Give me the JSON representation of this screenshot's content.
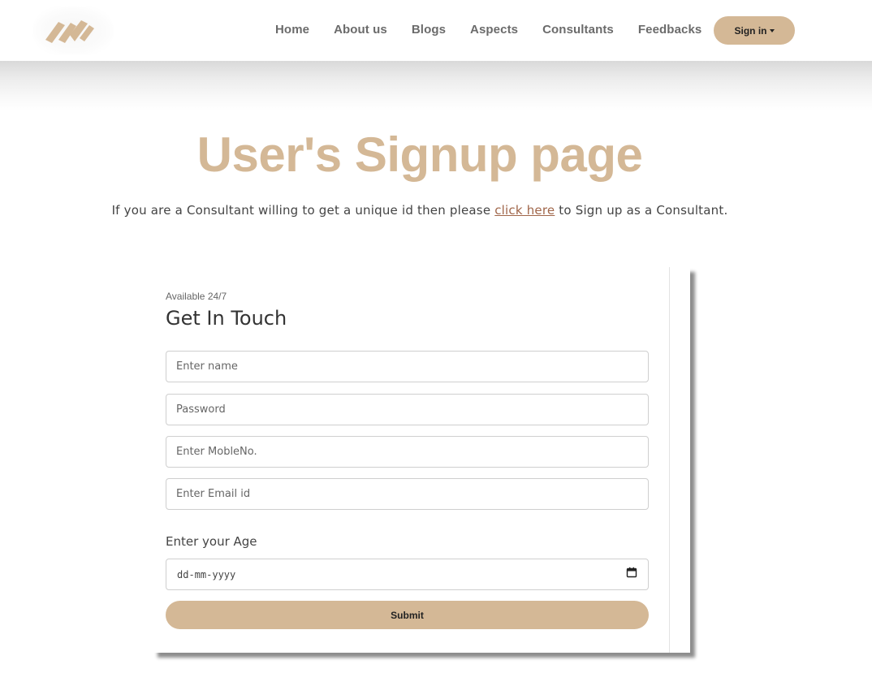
{
  "nav": {
    "links": [
      "Home",
      "About us",
      "Blogs",
      "Aspects",
      "Consultants",
      "Feedbacks"
    ],
    "signin_label": "Sign in"
  },
  "page": {
    "title": "User's Signup page",
    "subtitle_before": "If you are a Consultant willing to get a unique id then please ",
    "subtitle_link": "click here",
    "subtitle_after": " to Sign up as a Consultant."
  },
  "form": {
    "available": "Available 24/7",
    "heading": "Get In Touch",
    "name_placeholder": "Enter name",
    "password_placeholder": "Password",
    "mobile_placeholder": "Enter MobleNo.",
    "email_placeholder": "Enter Email id",
    "age_label": "Enter your Age",
    "date_placeholder": "dd-mm-yyyy",
    "submit_label": "Submit"
  },
  "colors": {
    "accent": "#d4b896",
    "link": "#a0664a",
    "nav_text": "#6b6b6b"
  },
  "icons": {
    "logo": "brand-logo-icon",
    "calendar": "calendar-icon",
    "dropdown": "caret-down-icon"
  }
}
